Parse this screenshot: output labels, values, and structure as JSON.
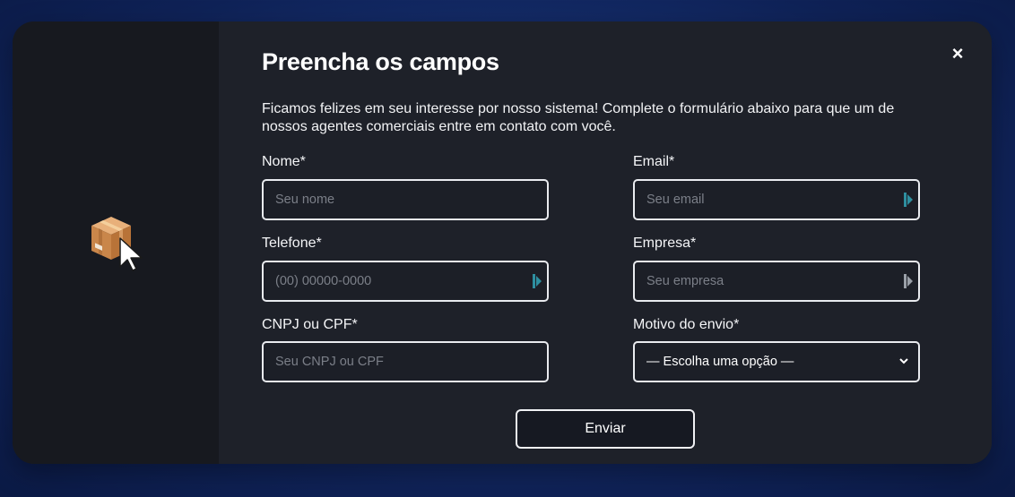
{
  "modal": {
    "close_symbol": "×",
    "title": "Preencha os campos",
    "description": "Ficamos felizes em seu interesse por nosso sistema! Complete o formulário abaixo para que um de nossos agentes comerciais entre em contato com você.",
    "submit_label": "Enviar"
  },
  "form": {
    "name": {
      "label": "Nome*",
      "placeholder": "Seu nome"
    },
    "email": {
      "label": "Email*",
      "placeholder": "Seu email"
    },
    "phone": {
      "label": "Telefone*",
      "placeholder": "(00) 00000-0000"
    },
    "company": {
      "label": "Empresa*",
      "placeholder": "Seu empresa"
    },
    "document": {
      "label": "CNPJ ou CPF*",
      "placeholder": "Seu CNPJ ou CPF"
    },
    "reason": {
      "label": "Motivo do envio*",
      "selected": "— Escolha uma opção —"
    }
  },
  "icons": {
    "illustration": "package-box-with-cursor-icon",
    "close": "close-icon",
    "password-manager": "keypass-extension-icon"
  },
  "colors": {
    "modal_background": "#1e2129",
    "sidebar_background": "#17191f",
    "page_background": "#173274",
    "accent_teal": "#2e8fa0"
  }
}
